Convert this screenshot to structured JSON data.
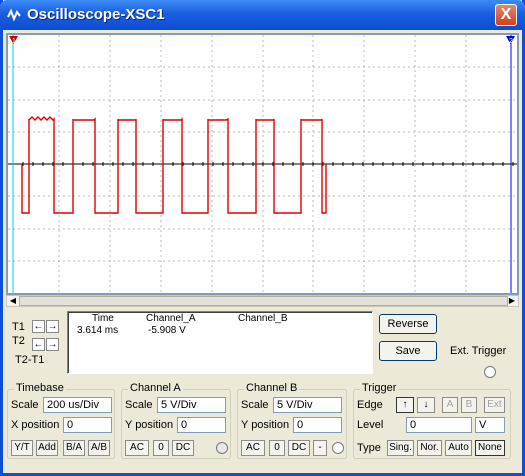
{
  "window": {
    "title": "Oscilloscope-XSC1",
    "close_symbol": "X"
  },
  "screen": {
    "background": "#ffffff",
    "trace_color": "#e00000",
    "axis_color": "#000000",
    "grid_color": "#b8b8b8",
    "t1_cursor_color": "#00c8ff",
    "t2_cursor_color": "#0000ff",
    "t1_marker": "1",
    "t2_marker": "2"
  },
  "cursors": {
    "t1": "T1",
    "t2": "T2",
    "t2_t1": "T2-T1",
    "left_arrow": "←",
    "right_arrow": "→"
  },
  "readout": {
    "headers": {
      "time": "Time",
      "channel_a": "Channel_A",
      "channel_b": "Channel_B"
    },
    "row_t1": {
      "time": "3.614 ms",
      "channel_a": "-5.908 V"
    }
  },
  "actions": {
    "reverse": "Reverse",
    "save": "Save",
    "ext_trigger": "Ext. Trigger"
  },
  "timebase": {
    "title": "Timebase",
    "scale_label": "Scale",
    "scale_value": "200 us/Div",
    "xpos_label": "X position",
    "xpos_value": "0",
    "modes": [
      "Y/T",
      "Add",
      "B/A",
      "A/B"
    ]
  },
  "channel_a": {
    "title": "Channel A",
    "scale_label": "Scale",
    "scale_value": "5  V/Div",
    "ypos_label": "Y position",
    "ypos_value": "0",
    "coupling": [
      "AC",
      "0",
      "DC"
    ]
  },
  "channel_b": {
    "title": "Channel B",
    "scale_label": "Scale",
    "scale_value": "5  V/Div",
    "ypos_label": "Y position",
    "ypos_value": "0",
    "coupling": [
      "AC",
      "0",
      "DC",
      "-"
    ]
  },
  "trigger": {
    "title": "Trigger",
    "edge_label": "Edge",
    "edge_buttons": [
      "↑",
      "↓",
      "A",
      "B",
      "Ext"
    ],
    "level_label": "Level",
    "level_value": "0",
    "level_unit": "V",
    "type_label": "Type",
    "types": [
      "Sing.",
      "Nor.",
      "Auto",
      "None"
    ]
  }
}
